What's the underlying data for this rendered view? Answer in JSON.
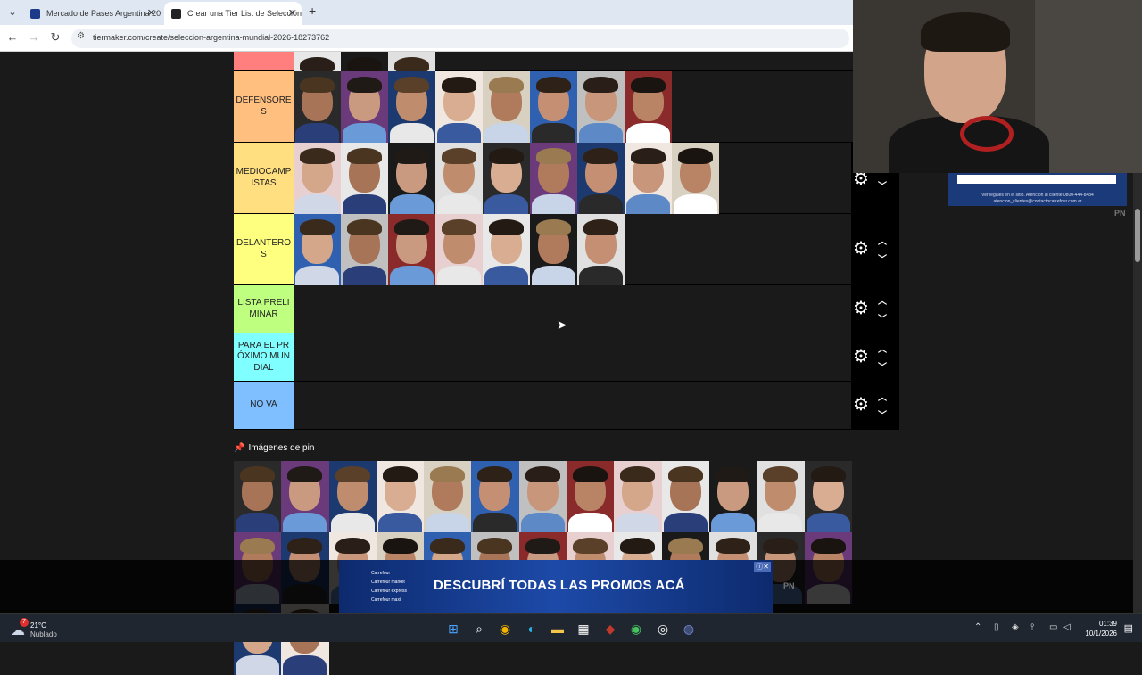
{
  "browser": {
    "tabs": [
      {
        "label": "Mercado de Pases Argentina 20",
        "favicon_color": "#1b3a8a"
      },
      {
        "label": "Crear una Tier List de Selección",
        "favicon_color": "#222222"
      }
    ],
    "url": "tiermaker.com/create/seleccion-argentina-mundial-2026-18273762"
  },
  "tiers": [
    {
      "label": "",
      "color": "#ff7f7f",
      "count": 3,
      "partial": true
    },
    {
      "label": "DEFENSORES",
      "color": "#ffbf7f",
      "count": 8
    },
    {
      "label": "MEDIOCAMPISTAS",
      "color": "#ffdf7f",
      "count": 9
    },
    {
      "label": "DELANTEROS",
      "color": "#ffff7f",
      "count": 7
    },
    {
      "label": "LISTA PRELIMINAR",
      "color": "#bfff7f",
      "count": 0
    },
    {
      "label": "PARA EL PRÓXIMO MUNDIAL",
      "color": "#7fffff",
      "count": 0
    },
    {
      "label": "NO VA",
      "color": "#7fbfff",
      "count": 0
    }
  ],
  "pin_section": {
    "title": "Imágenes de pin"
  },
  "side_ad": {
    "text": "Ver legales en el sitio. Atención al cliente 0800-444-8484 atencion_clientes@contactocarrefour.com.ar"
  },
  "ad": {
    "text": "DESCUBRÍ TODAS LAS PROMOS ACÁ",
    "brand_lines": [
      "Carrefour",
      "Carrefour market",
      "Carrefour express",
      "Carrefour maxi"
    ],
    "close": "ⓘ✕"
  },
  "watermark": "PN",
  "taskbar": {
    "temp": "21°C",
    "weather": "Nublado",
    "weather_badge": "7",
    "time": "01:39",
    "date": "10/1/2026"
  }
}
